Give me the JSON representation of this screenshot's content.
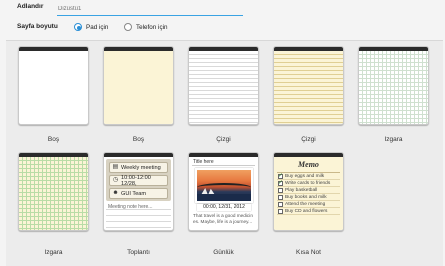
{
  "header": {
    "name_label": "Adlandır",
    "name_placeholder": "Dizüstü1",
    "size_label": "Sayfa boyutu",
    "size_options": [
      {
        "label": "Pad için",
        "selected": true
      },
      {
        "label": "Telefon için",
        "selected": false
      }
    ]
  },
  "templates": [
    {
      "label": "Boş"
    },
    {
      "label": "Boş"
    },
    {
      "label": "Çizgi"
    },
    {
      "label": "Çizgi"
    },
    {
      "label": "Izgara"
    },
    {
      "label": "Izgara"
    },
    {
      "label": "Toplantı"
    },
    {
      "label": "Günlük"
    },
    {
      "label": "Kısa Not"
    }
  ],
  "meeting": {
    "title": "Weekly meeting",
    "time": "10:00-12:00 12/28,",
    "team": "GUI Team",
    "notes": "Meeting note here..."
  },
  "diary": {
    "title": "Title here",
    "date": "00:00, 12/31, 2012",
    "text": "That travel is a good medicin es. Maybe, life is a journey..."
  },
  "memo": {
    "title": "Memo",
    "items": [
      {
        "text": "Buy eggs and milk",
        "checked": true
      },
      {
        "text": "Write cards to friends",
        "checked": true
      },
      {
        "text": "Play basketball",
        "checked": false
      },
      {
        "text": "Buy books and milk",
        "checked": false
      },
      {
        "text": "Attend the meeting",
        "checked": false
      },
      {
        "text": "Buy CD and flowers",
        "checked": false
      }
    ]
  },
  "colors": {
    "accent": "#2a8fd6",
    "card_bar": "#2b2b2b",
    "yellow_paper": "#fbf4d6"
  }
}
